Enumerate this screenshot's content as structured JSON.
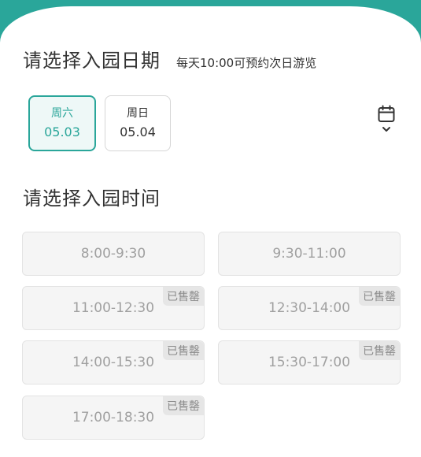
{
  "date_section": {
    "title": "请选择入园日期",
    "hint": "每天10:00可预约次日游览",
    "dates": [
      {
        "weekday": "周六",
        "date": "05.03",
        "selected": true
      },
      {
        "weekday": "周日",
        "date": "05.04",
        "selected": false
      }
    ],
    "calendar_icon": "calendar-icon"
  },
  "time_section": {
    "title": "请选择入园时间",
    "sold_out_label": "已售罄",
    "slots": [
      {
        "time": "8:00-9:30",
        "sold_out": false
      },
      {
        "time": "9:30-11:00",
        "sold_out": false
      },
      {
        "time": "11:00-12:30",
        "sold_out": true
      },
      {
        "time": "12:30-14:00",
        "sold_out": true
      },
      {
        "time": "14:00-15:30",
        "sold_out": true
      },
      {
        "time": "15:30-17:00",
        "sold_out": true
      },
      {
        "time": "17:00-18:30",
        "sold_out": true
      }
    ]
  },
  "colors": {
    "accent": "#2aa69a",
    "slot_bg": "#f5f5f5",
    "slot_text": "#a0a0a0"
  }
}
